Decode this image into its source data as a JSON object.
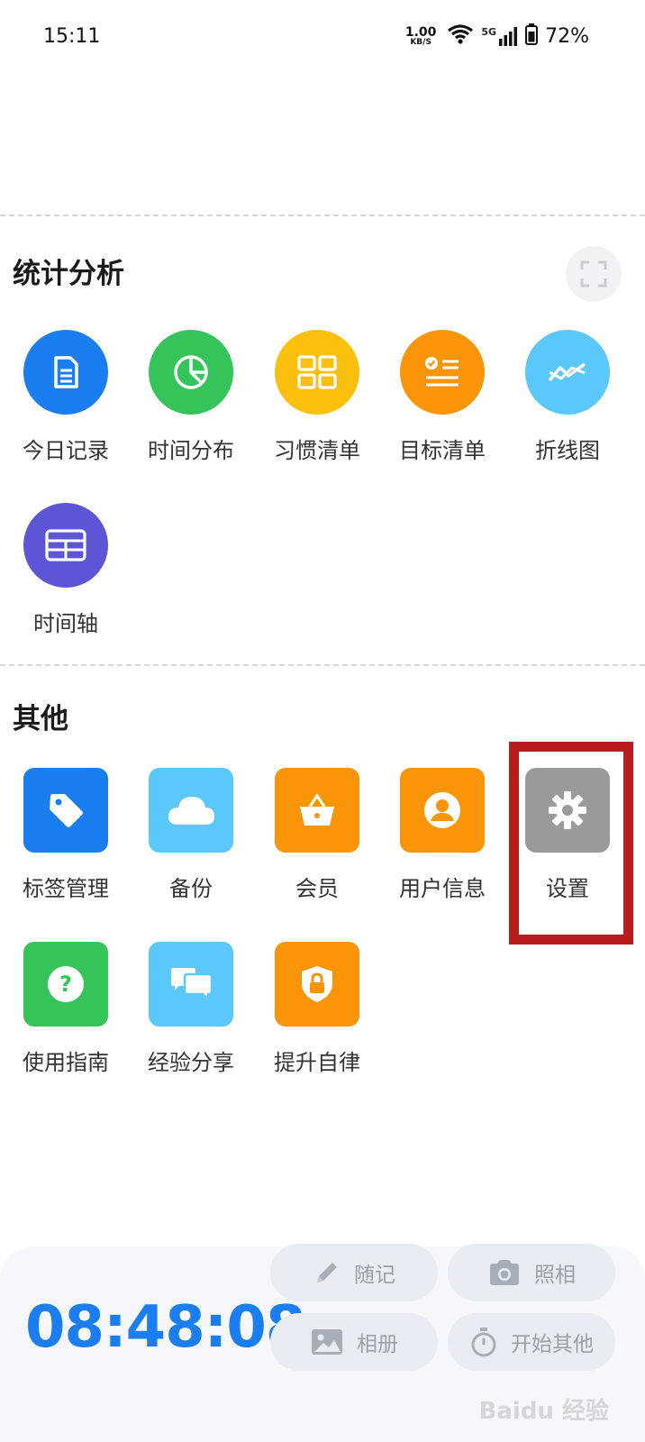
{
  "status_bar": {
    "time": "15:11",
    "net_speed_value": "1.00",
    "net_speed_unit": "KB/S",
    "network_type": "5G",
    "battery": "72%"
  },
  "stats_section": {
    "title": "统计分析",
    "items": [
      {
        "label": "今日记录",
        "icon": "document-icon",
        "color": "#1a7ef0"
      },
      {
        "label": "时间分布",
        "icon": "pie-chart-icon",
        "color": "#34c45a"
      },
      {
        "label": "习惯清单",
        "icon": "grid-icon",
        "color": "#fbbf0e"
      },
      {
        "label": "目标清单",
        "icon": "checklist-icon",
        "color": "#fb9508"
      },
      {
        "label": "折线图",
        "icon": "line-chart-icon",
        "color": "#5ac8fa"
      },
      {
        "label": "时间轴",
        "icon": "table-icon",
        "color": "#5c55d6"
      }
    ]
  },
  "other_section": {
    "title": "其他",
    "items": [
      {
        "label": "标签管理",
        "icon": "tag-icon",
        "color": "#1a7ef0"
      },
      {
        "label": "备份",
        "icon": "cloud-icon",
        "color": "#5ac8fa"
      },
      {
        "label": "会员",
        "icon": "basket-icon",
        "color": "#fb9508"
      },
      {
        "label": "用户信息",
        "icon": "user-icon",
        "color": "#fb9508"
      },
      {
        "label": "设置",
        "icon": "gear-icon",
        "color": "#9a9a9a"
      },
      {
        "label": "使用指南",
        "icon": "question-icon",
        "color": "#34c45a"
      },
      {
        "label": "经验分享",
        "icon": "chat-icon",
        "color": "#5ac8fa"
      },
      {
        "label": "提升自律",
        "icon": "lock-shield-icon",
        "color": "#fb9508"
      }
    ]
  },
  "bottom_bar": {
    "timer": "08:48:08",
    "buttons": {
      "note": "随记",
      "photo": "照相",
      "album": "相册",
      "start_other": "开始其他"
    }
  },
  "watermark": "Baidu 经验"
}
